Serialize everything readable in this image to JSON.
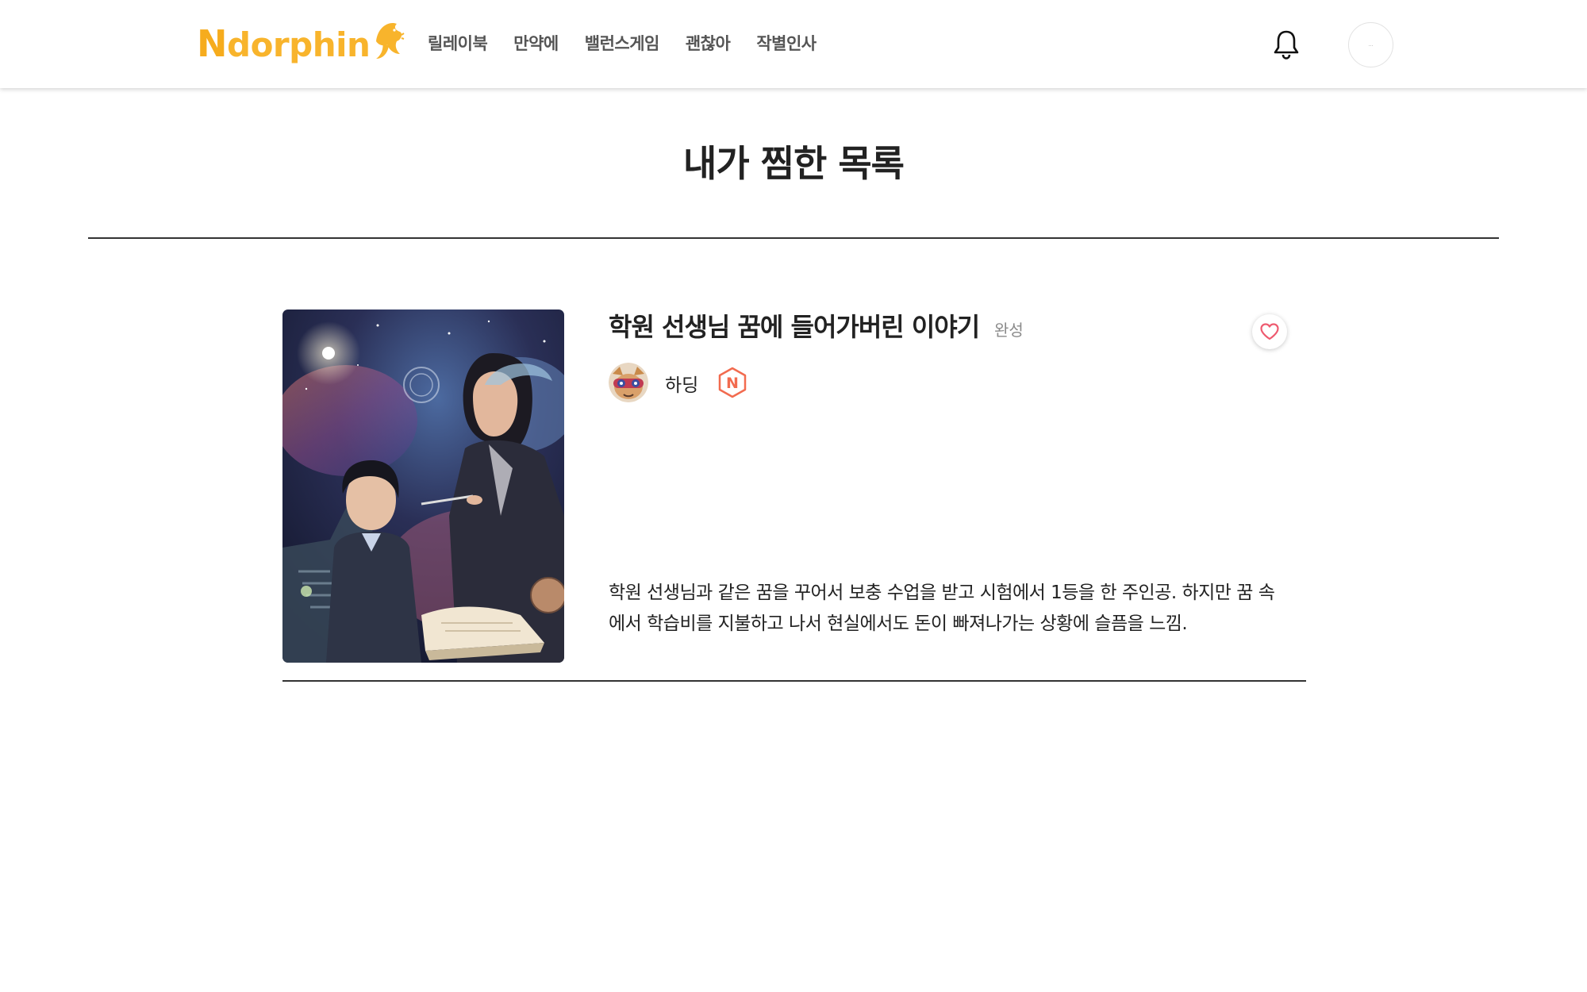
{
  "header": {
    "logo_text_first": "N",
    "logo_text_rest": "dorphin",
    "nav": [
      "릴레이북",
      "만약에",
      "밸런스게임",
      "괜찮아",
      "작별인사"
    ],
    "profile_text": "..."
  },
  "page": {
    "title": "내가 찜한 목록"
  },
  "items": [
    {
      "title": "학원 선생님 꿈에 들어가버린 이야기",
      "status": "완성",
      "author": "하딩",
      "badge_letter": "N",
      "description": "학원 선생님과 같은 꿈을 꾸어서 보충 수업을 받고 시험에서 1등을 한 주인공. 하지만 꿈 속에서 학습비를 지불하고 나서 현실에서도 돈이 빠져나가는 상황에 슬픔을 느낌."
    }
  ],
  "colors": {
    "brand_yellow": "#f8b42c",
    "heart": "#ee5a6f",
    "badge": "#f26b4f"
  },
  "icons": {
    "bell": "bell-icon",
    "heart": "heart-icon",
    "badge": "hexagon-n-badge-icon"
  }
}
